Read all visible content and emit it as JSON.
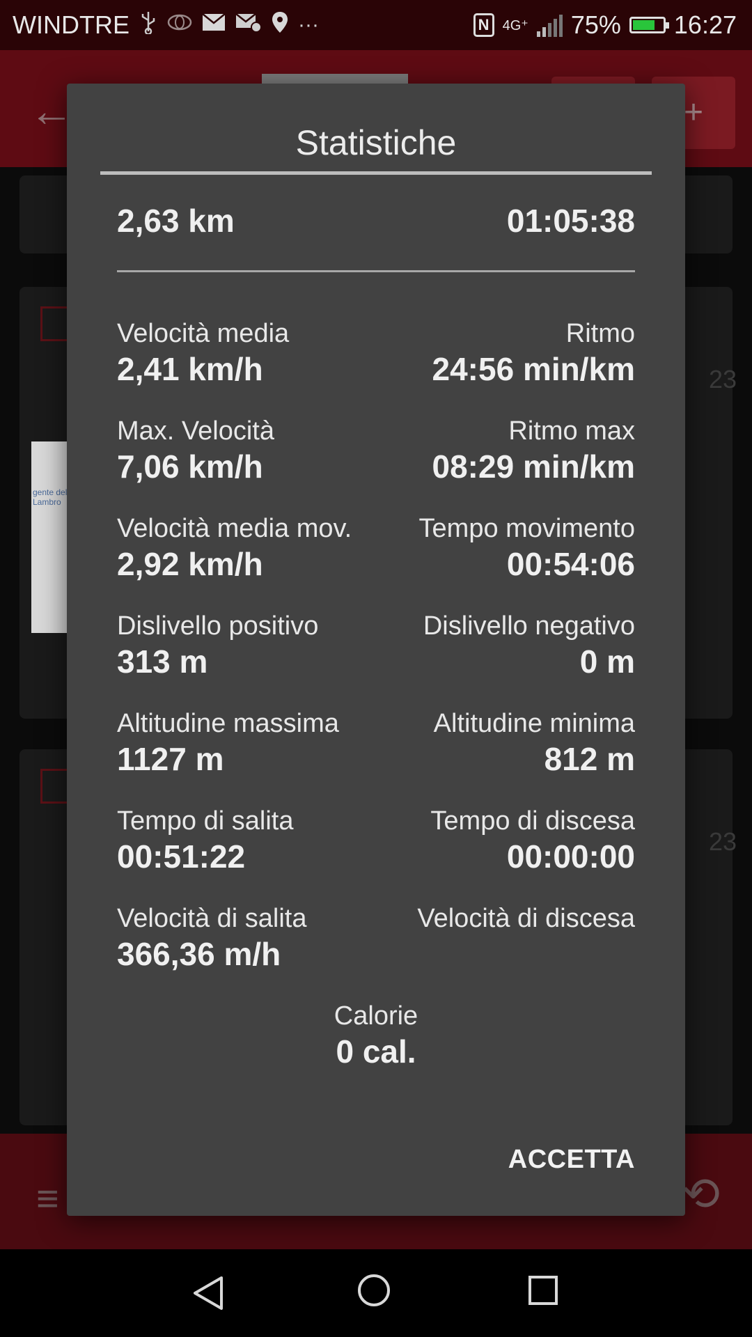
{
  "status_bar": {
    "carrier": "WINDTRE",
    "network": "4G⁺",
    "battery_percent": "75%",
    "battery_level": 0.75,
    "time": "16:27",
    "icons": [
      "usb-icon",
      "car-icon",
      "mail-icon",
      "mail-gear-icon",
      "location-icon",
      "more-icon",
      "nfc-icon",
      "signal-icon",
      "battery-icon"
    ]
  },
  "dialog": {
    "title": "Statistiche",
    "summary": {
      "distance": "2,63 km",
      "duration": "01:05:38"
    },
    "stats": [
      {
        "left": {
          "label": "Velocità media",
          "value": "2,41 km/h"
        },
        "right": {
          "label": "Ritmo",
          "value": "24:56 min/km"
        }
      },
      {
        "left": {
          "label": "Max. Velocità",
          "value": "7,06 km/h"
        },
        "right": {
          "label": "Ritmo max",
          "value": "08:29 min/km"
        }
      },
      {
        "left": {
          "label": "Velocità media mov.",
          "value": "2,92 km/h"
        },
        "right": {
          "label": "Tempo movimento",
          "value": "00:54:06"
        }
      },
      {
        "left": {
          "label": "Dislivello positivo",
          "value": "313 m"
        },
        "right": {
          "label": "Dislivello negativo",
          "value": "0 m"
        }
      },
      {
        "left": {
          "label": "Altitudine massima",
          "value": "1127 m"
        },
        "right": {
          "label": "Altitudine minima",
          "value": "812 m"
        }
      },
      {
        "left": {
          "label": "Tempo di salita",
          "value": "00:51:22"
        },
        "right": {
          "label": "Tempo di discesa",
          "value": "00:00:00"
        }
      },
      {
        "left": {
          "label": "Velocità di salita",
          "value": "366,36 m/h"
        },
        "right": {
          "label": "Velocità di discesa",
          "value": ""
        }
      }
    ],
    "calories": {
      "label": "Calorie",
      "value": "0 cal."
    },
    "accept_button": "ACCETTA"
  },
  "background": {
    "card_side_text_1": "23",
    "card_side_text_2": "23",
    "card_image_text": "gente del Lambro"
  },
  "colors": {
    "status_bar": "#2a0406",
    "app_bar": "#5e0b13",
    "dialog_bg": "#424242",
    "battery_fill": "#29c53b"
  }
}
